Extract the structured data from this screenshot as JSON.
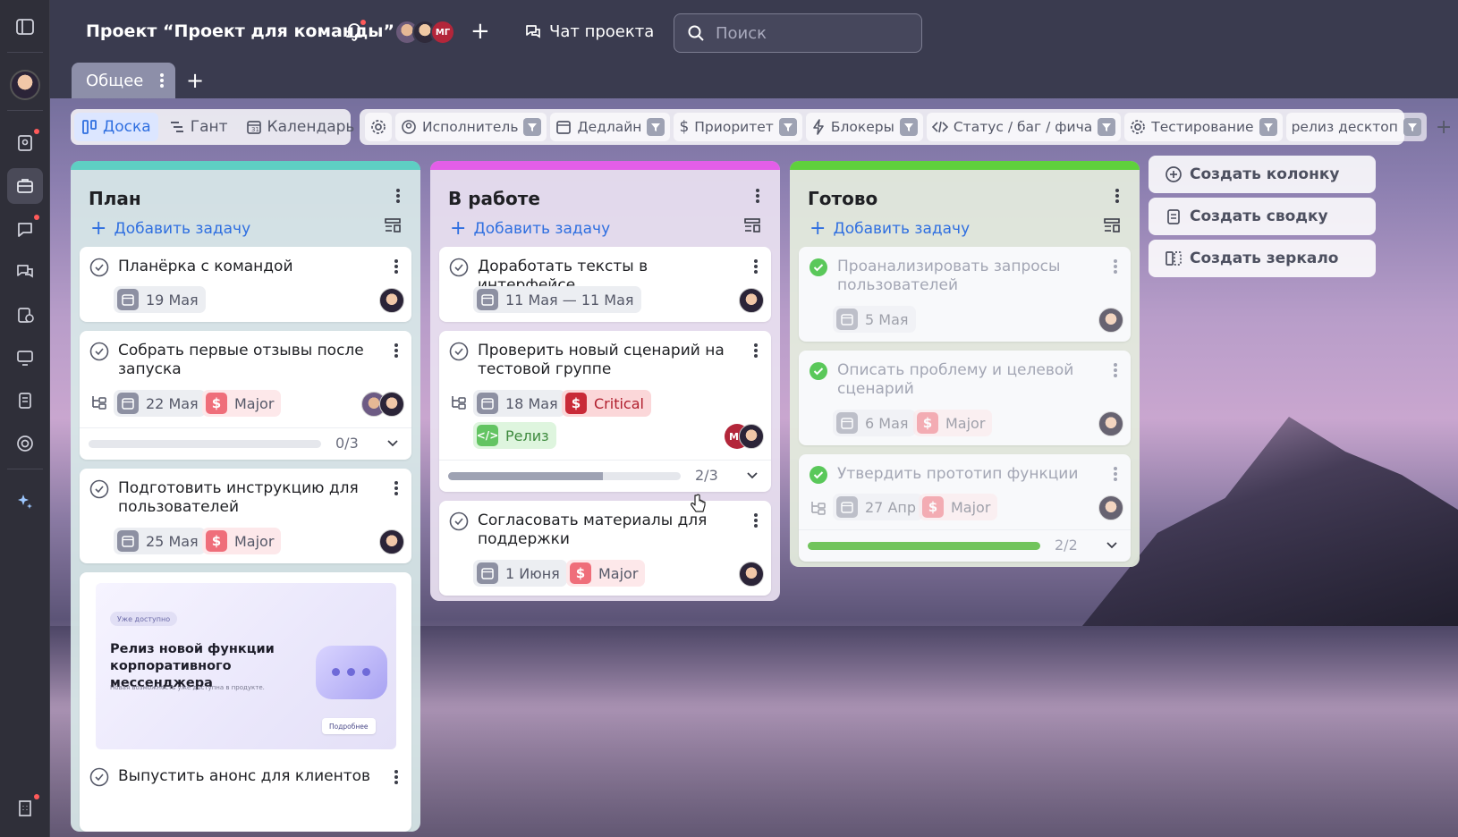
{
  "header": {
    "project_title": "Проект “Проект для команды”",
    "avatar_initials": "МГ",
    "chat_label": "Чат проекта",
    "search_placeholder": "Поиск"
  },
  "tabs": {
    "active": "Общее"
  },
  "views": [
    "Доска",
    "Гант",
    "Календарь"
  ],
  "filters": [
    "Исполнитель",
    "Дедлайн",
    "Приоритет",
    "Блокеры",
    "Статус / баг / фича",
    "Тестирование",
    "релиз десктоп"
  ],
  "columns": [
    {
      "title": "План",
      "accent": "#5ecfc3",
      "add_label": "Добавить задачу",
      "cards": [
        {
          "title": "Планёрка с командой",
          "date": "19 Мая"
        },
        {
          "title": "Собрать первые отзывы после запуска",
          "date": "22 Мая",
          "priority": "Major",
          "progress_text": "0/3",
          "progress": 0
        },
        {
          "title": "Подготовить инструкцию для пользователей",
          "date": "25 Мая",
          "priority": "Major"
        },
        {
          "promo": {
            "badge": "Уже доступно",
            "title": "Релиз новой функции корпоративного мессенджера",
            "subtitle": "Новая возможность уже доступна в продукте.",
            "button": "Подробнее"
          },
          "title": "Выпустить анонс для клиентов"
        }
      ]
    },
    {
      "title": "В работе",
      "accent": "#e35ee8",
      "add_label": "Добавить задачу",
      "cards": [
        {
          "title": "Доработать тексты в интерфейсе",
          "date": "11 Мая — 11 Мая"
        },
        {
          "title": "Проверить новый сценарий на тестовой группе",
          "date": "18 Мая",
          "priority": "Critical",
          "tag": "Релиз",
          "avatar_initials": "МГ",
          "progress_text": "2/3",
          "progress": 0.667
        },
        {
          "title": "Согласовать материалы для поддержки",
          "date": "1 Июня",
          "priority": "Major"
        }
      ]
    },
    {
      "title": "Готово",
      "accent": "#5fd03c",
      "add_label": "Добавить задачу",
      "cards": [
        {
          "title": "Проанализировать запросы пользователей",
          "date": "5 Мая"
        },
        {
          "title": "Описать проблему и целевой сценарий",
          "date": "6 Мая",
          "priority": "Major"
        },
        {
          "title": "Утвердить прототип функции",
          "date": "27 Апр",
          "priority": "Major",
          "progress_text": "2/2",
          "progress": 1
        }
      ]
    }
  ],
  "side_actions": [
    "Создать колонку",
    "Создать сводку",
    "Создать зеркало"
  ]
}
